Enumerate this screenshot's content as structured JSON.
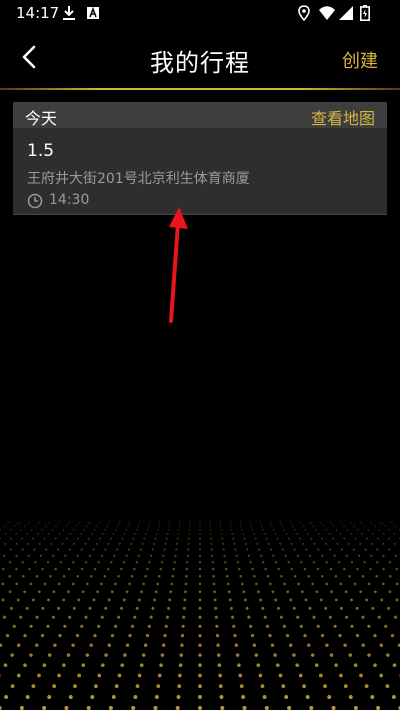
{
  "status_bar": {
    "time": "14:17",
    "left_icons": [
      "download-icon",
      "app-icon"
    ],
    "right_icons": [
      "location-icon",
      "wifi-icon",
      "signal-icon",
      "battery-icon"
    ]
  },
  "header": {
    "title": "我的行程",
    "create_label": "创建",
    "back_icon": "chevron-left-icon"
  },
  "section": {
    "label": "今天",
    "view_map_label": "查看地图"
  },
  "trips": [
    {
      "title": "1.5",
      "address": "王府井大街201号北京利生体育商厦",
      "time": "14:30",
      "time_icon": "clock-icon"
    }
  ],
  "colors": {
    "accent": "#d9b540",
    "background": "#000000",
    "section_bg": "#3e3e3e",
    "card_bg": "#2e2e2e",
    "secondary_text": "#9a9a9a",
    "annotation_arrow": "#e8161b"
  }
}
